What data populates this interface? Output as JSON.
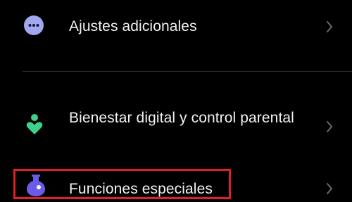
{
  "settings": {
    "items": [
      {
        "label": "Ajustes adicionales",
        "icon": "more-horizontal-icon",
        "icon_color": "#9fa8f0"
      },
      {
        "label": "Bienestar digital y control parental",
        "icon": "digital-wellbeing-icon",
        "icon_color": "#3fd08a"
      },
      {
        "label": "Funciones especiales",
        "icon": "flask-icon",
        "icon_color": "#6a5ce8"
      }
    ]
  },
  "colors": {
    "background": "#000000",
    "text": "#f2f2f2",
    "chevron": "#6b6b6b",
    "divider": "#2a2a2a",
    "highlight": "#e31e24"
  }
}
